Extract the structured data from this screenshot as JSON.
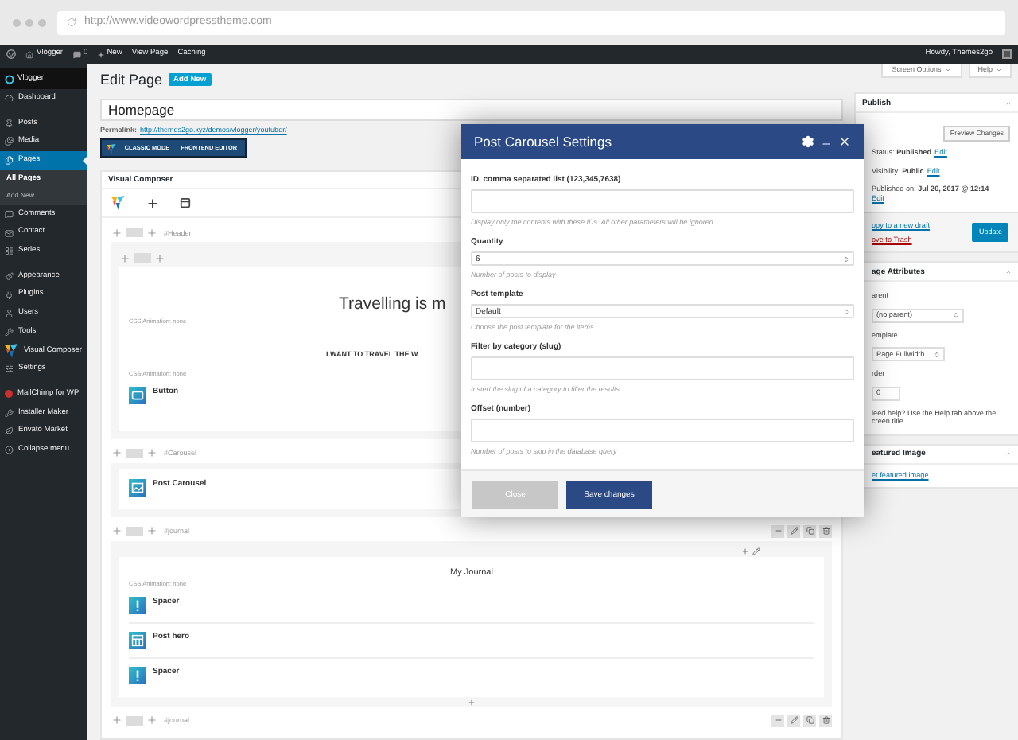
{
  "browser": {
    "url": "http://www.videowordpresstheme.com"
  },
  "admin_bar": {
    "site": "Vlogger",
    "comments": "0",
    "new": "New",
    "items": [
      "View Page",
      "Caching"
    ],
    "greeting": "Howdy, Themes2go"
  },
  "sidebar": {
    "site": "Vlogger",
    "groups": [
      {
        "items": [
          {
            "label": "Dashboard",
            "selected": false
          }
        ]
      },
      {
        "items": [
          {
            "label": "Posts",
            "selected": false
          },
          {
            "label": "Media",
            "selected": false
          },
          {
            "label": "Pages",
            "selected": true,
            "children": [
              {
                "label": "All Pages",
                "selected": true
              },
              {
                "label": "Add New",
                "selected": false
              }
            ]
          },
          {
            "label": "Comments",
            "selected": false
          },
          {
            "label": "Contact",
            "selected": false
          },
          {
            "label": "Series",
            "selected": false
          }
        ]
      },
      {
        "items": [
          {
            "label": "Appearance",
            "selected": false
          },
          {
            "label": "Plugins",
            "selected": false
          },
          {
            "label": "Users",
            "selected": false
          },
          {
            "label": "Tools",
            "selected": false
          },
          {
            "label": "Visual Composer",
            "selected": false
          },
          {
            "label": "Settings",
            "selected": false
          }
        ]
      },
      {
        "items": [
          {
            "label": "MailChimp for WP",
            "selected": false
          },
          {
            "label": "Installer Maker",
            "selected": false
          },
          {
            "label": "Envato Market",
            "selected": false
          },
          {
            "label": "Collapse menu",
            "selected": false
          }
        ]
      }
    ]
  },
  "screen_options": "Screen Options",
  "help": "Help",
  "page": {
    "heading": "Edit Page",
    "add_new": "Add New",
    "title_value": "Homepage",
    "permalink_label": "Permalink:",
    "permalink": "http://themes2go.xyz/demos/vlogger/youtuber/"
  },
  "editor_modes": [
    "CLASSIC MODE",
    "FRONTEND EDITOR"
  ],
  "composer": {
    "title": "Visual Composer",
    "rows": [
      {
        "name": "#Header",
        "inner_row": true,
        "tools": false,
        "items": [
          {
            "kind": "heading",
            "text": "Travelling is m"
          },
          {
            "kind": "note",
            "text": "CSS Animation: none"
          },
          {
            "kind": "caps",
            "text": "I WANT TO TRAVEL THE W"
          },
          {
            "kind": "note",
            "text": "CSS Animation: none"
          },
          {
            "kind": "button",
            "text": "Button"
          }
        ]
      },
      {
        "name": "#Carousel",
        "inner_row": false,
        "tools": false,
        "items": [
          {
            "kind": "carousel",
            "text": "Post Carousel"
          }
        ]
      },
      {
        "name": "#journal",
        "inner_row": false,
        "tools": true,
        "items": [
          {
            "kind": "title",
            "text": "My Journal"
          },
          {
            "kind": "note",
            "text": "CSS Animation: none"
          },
          {
            "kind": "spacer",
            "text": "Spacer"
          },
          {
            "kind": "grid",
            "text": "Post hero"
          },
          {
            "kind": "spacer",
            "text": "Spacer"
          }
        ]
      },
      {
        "name": "#journal",
        "tools": true
      }
    ]
  },
  "publish": {
    "title": "Publish",
    "preview": "Preview Changes",
    "meta": [
      {
        "text": "Status: **Published**",
        "link": "Edit"
      },
      {
        "text": "Visibility: **Public**",
        "link": "Edit"
      },
      {
        "text": "Published on: **Jul 20, 2017 @ 12:14**",
        "link": "Edit"
      }
    ],
    "copy": "opy to a new draft",
    "trash": "ove to Trash",
    "update": "Update"
  },
  "page_attributes": {
    "title": "age Attributes",
    "parent_label": "arent",
    "parent": "(no parent)",
    "template_label": "emplate",
    "template": "Page Fullwidth",
    "order_label": "rder",
    "order": "0",
    "help_lines": [
      "leed help? Use the Help tab above the",
      "creen title."
    ]
  },
  "featured": {
    "title": "eatured Image",
    "link": "et featured image"
  },
  "modal": {
    "title": "Post Carousel Settings",
    "fields": [
      {
        "kind": "text",
        "label": "ID, comma separated list (123,345,7638)",
        "hint": "Display only the contents with these IDs. All other parameters will be ignored."
      },
      {
        "kind": "select",
        "label": "Quantity",
        "value": "6",
        "hint": "Number of posts to display"
      },
      {
        "kind": "select",
        "label": "Post template",
        "value": "Default",
        "hint": "Choose the post template for the items"
      },
      {
        "kind": "text",
        "label": "Filter by category (slug)",
        "hint": "Instert the slug of a category to filter the results"
      },
      {
        "kind": "text",
        "label": "Offset (number)",
        "hint": "Number of posts to skip in the database query"
      }
    ],
    "buttons": [
      {
        "label": "Close",
        "kind": "secondary"
      },
      {
        "label": "Save changes",
        "kind": "primary"
      }
    ]
  }
}
